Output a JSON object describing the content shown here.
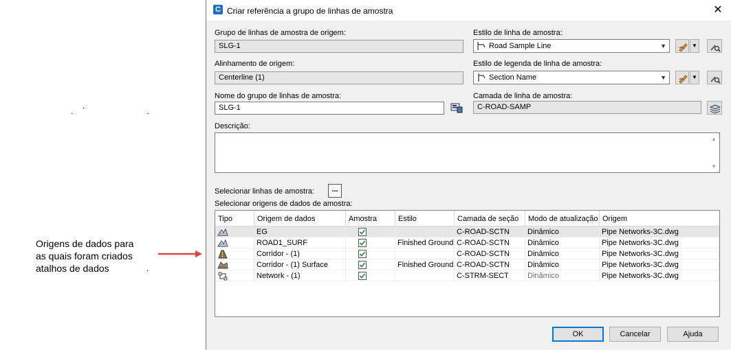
{
  "annotation": {
    "line1": "Origens de dados para",
    "line2": "as quais foram criados",
    "line3": "atalhos de dados",
    "arrow_color": "#d9463e"
  },
  "dialog": {
    "title": "Criar referência a grupo de linhas de amostra",
    "close_icon": "close-icon",
    "source_group_label": "Grupo de linhas de amostra de origem:",
    "source_group_value": "SLG-1",
    "source_alignment_label": "Alinhamento de origem:",
    "source_alignment_value": "Centerline (1)",
    "group_name_label": "Nome do grupo de linhas de amostra:",
    "group_name_value": "SLG-1",
    "sample_line_style_label": "Estilo de linha de amostra:",
    "sample_line_style_value": "Road Sample Line",
    "label_style_label": "Estilo de legenda de linha de amostra:",
    "label_style_value": "Section Name",
    "layer_label": "Camada de linha de amostra:",
    "layer_value": "C-ROAD-SAMP",
    "description_label": "Descrição:",
    "description_value": "",
    "select_lines_label": "Selecionar linhas de amostra:",
    "select_lines_button": "...",
    "select_sources_label": "Selecionar origens de dados de amostra:"
  },
  "grid": {
    "columns": [
      "Tipo",
      "Origem de dados",
      "Amostra",
      "Estilo",
      "Camada de seção",
      "Modo de atualização",
      "Origem"
    ],
    "rows": [
      {
        "icon": "surface-icon",
        "source": "EG",
        "sample": true,
        "style": "",
        "layer": "C-ROAD-SCTN",
        "mode": "Dinâmico",
        "mode_gray": false,
        "origin": "Pipe Networks-3C.dwg",
        "selected": true
      },
      {
        "icon": "surface-icon",
        "source": "ROAD1_SURF",
        "sample": true,
        "style": "Finished Ground",
        "layer": "C-ROAD-SCTN",
        "mode": "Dinâmico",
        "mode_gray": false,
        "origin": "Pipe Networks-3C.dwg",
        "selected": false
      },
      {
        "icon": "corridor-icon",
        "source": "Corridor - (1)",
        "sample": true,
        "style": "",
        "layer": "C-ROAD-SCTN",
        "mode": "Dinâmico",
        "mode_gray": false,
        "origin": "Pipe Networks-3C.dwg",
        "selected": false
      },
      {
        "icon": "corridor-surface-icon",
        "source": "Corridor - (1) Surface",
        "sample": true,
        "style": "Finished Ground",
        "layer": "C-ROAD-SCTN",
        "mode": "Dinâmico",
        "mode_gray": false,
        "origin": "Pipe Networks-3C.dwg",
        "selected": false
      },
      {
        "icon": "pipe-network-icon",
        "source": "Network - (1)",
        "sample": true,
        "style": "",
        "layer": "C-STRM-SECT",
        "mode": "Dinâmico",
        "mode_gray": true,
        "origin": "Pipe Networks-3C.dwg",
        "selected": false
      }
    ]
  },
  "buttons": {
    "ok": "OK",
    "cancel": "Cancelar",
    "help": "Ajuda"
  }
}
